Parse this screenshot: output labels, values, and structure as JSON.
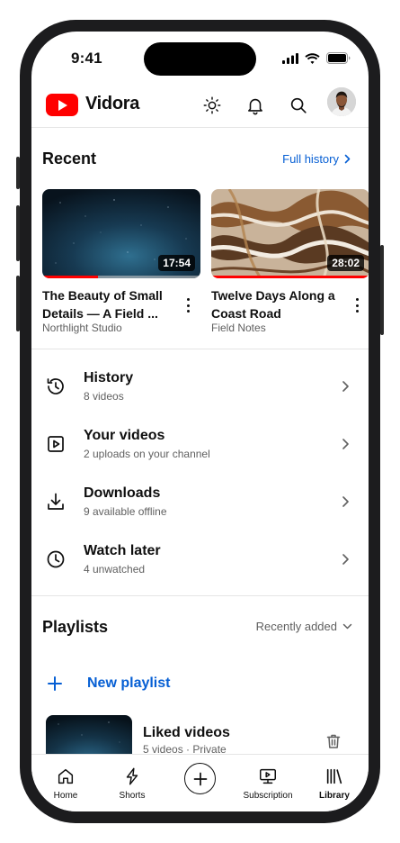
{
  "status": {
    "time": "9:41"
  },
  "header": {
    "brand": "Vidora"
  },
  "recent": {
    "title": "Recent",
    "link": "Full history",
    "videos": [
      {
        "title": "The Beauty of Small Details — A Field ...",
        "channel": "Northlight Studio",
        "duration": "17:54",
        "progress": 0.35
      },
      {
        "title": "Twelve Days Along a Coast Road",
        "channel": "Field Notes",
        "duration": "28:02",
        "progress": 1.0
      }
    ]
  },
  "library_items": [
    {
      "title": "History",
      "subtitle": "8 videos",
      "icon": "history-icon"
    },
    {
      "title": "Your videos",
      "subtitle": "2 uploads on your channel",
      "icon": "your-videos-icon"
    },
    {
      "title": "Downloads",
      "subtitle": "9 available offline",
      "icon": "download-icon"
    },
    {
      "title": "Watch later",
      "subtitle": "4 unwatched",
      "icon": "clock-icon"
    }
  ],
  "playlists": {
    "title": "Playlists",
    "sort": "Recently added",
    "new_label": "New playlist",
    "items": [
      {
        "title": "Liked videos",
        "subtitle": "5 videos · Private"
      }
    ]
  },
  "nav": [
    {
      "label": "Home",
      "icon": "home-icon",
      "active": false
    },
    {
      "label": "Shorts",
      "icon": "shorts-icon",
      "active": false
    },
    {
      "label": "",
      "icon": "create-icon",
      "active": false
    },
    {
      "label": "Subscription",
      "icon": "subscriptions-icon",
      "active": false
    },
    {
      "label": "Library",
      "icon": "library-icon",
      "active": true
    }
  ],
  "colors": {
    "accent": "#065fd4",
    "brand": "#ff0000",
    "text": "#0f0f0f",
    "muted": "#606060"
  }
}
